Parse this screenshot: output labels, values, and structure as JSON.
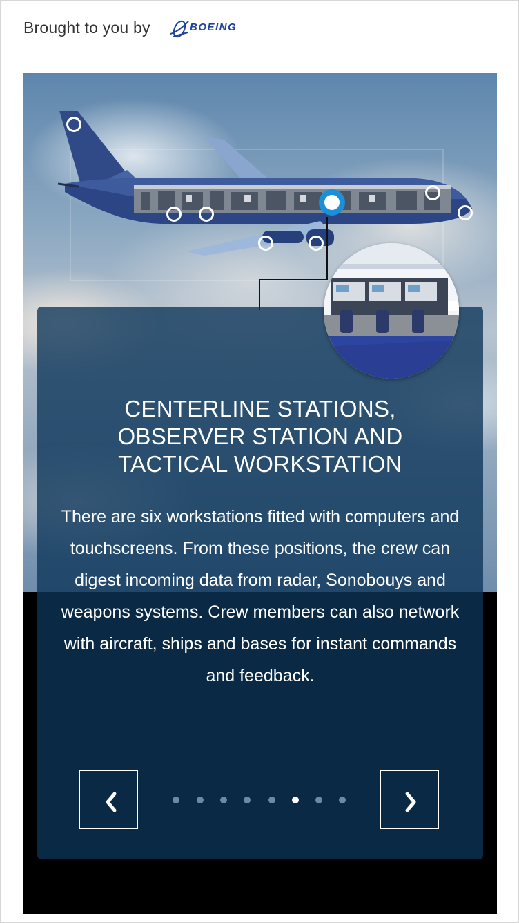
{
  "header": {
    "brought_label": "Brought to you by",
    "logo_text": "BOEING",
    "logo_color": "#1d439c"
  },
  "hotspots": {
    "count": 9,
    "active_index": 4,
    "active_color": "#1b8fd8"
  },
  "panel": {
    "title": "CENTERLINE STATIONS,\nOBSERVER STATION AND\nTACTICAL WORKSTATION",
    "body": "There are six workstations fitted with computers and touchscreens. From these positions, the crew can digest incoming data from radar, Sonobouys and weapons systems. Crew members can also network with aircraft, ships and bases for instant commands and feedback.",
    "background": "#0b3458"
  },
  "navigation": {
    "prev_icon": "chevron-left-icon",
    "next_icon": "chevron-right-icon",
    "total_slides": 8,
    "current_slide": 6
  }
}
